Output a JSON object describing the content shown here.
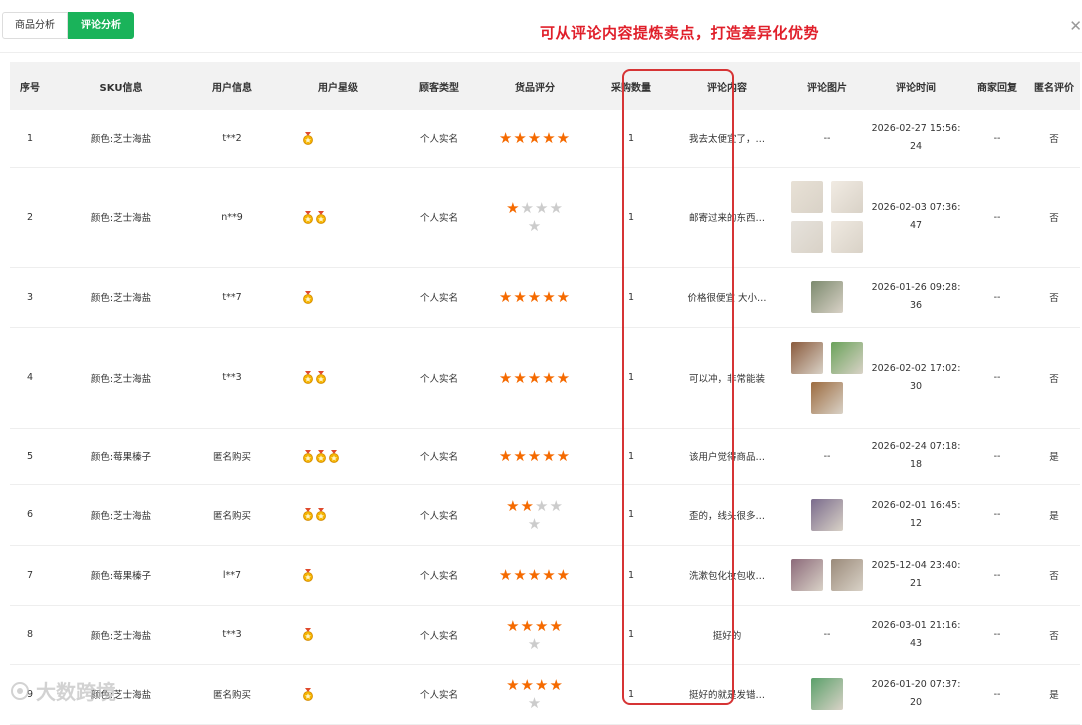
{
  "tabs": [
    {
      "label": "商品分析",
      "active": false
    },
    {
      "label": "评论分析",
      "active": true
    }
  ],
  "headline": "可从评论内容提炼卖点，打造差异化优势",
  "close_icon": "✕",
  "table": {
    "columns": [
      "序号",
      "SKU信息",
      "用户信息",
      "用户星级",
      "顾客类型",
      "货品评分",
      "采购数量",
      "评论内容",
      "评论图片",
      "评论时间",
      "商家回复",
      "匿名评价"
    ],
    "rows": [
      {
        "no": "1",
        "sku": "颜色:芝士海盐",
        "user": "t**2",
        "medals": 1,
        "type": "个人实名",
        "rating": 5,
        "qty": "1",
        "comment": "我去太便宜了，…",
        "images": [],
        "time_a": "2026-02-27 15:56:",
        "time_b": "24",
        "reply": "--",
        "anon": "否"
      },
      {
        "no": "2",
        "sku": "颜色:芝士海盐",
        "user": "n**9",
        "medals": 2,
        "type": "个人实名",
        "rating": 1,
        "qty": "1",
        "comment": "邮寄过来的东西…",
        "images": [
          "#e8e1d6",
          "#f1ebe3",
          "#e6e2dc",
          "#efe9e1"
        ],
        "time_a": "2026-02-03 07:36:",
        "time_b": "47",
        "reply": "--",
        "anon": "否"
      },
      {
        "no": "3",
        "sku": "颜色:芝士海盐",
        "user": "t**7",
        "medals": 1,
        "type": "个人实名",
        "rating": 5,
        "qty": "1",
        "comment": "价格很便宜 大小…",
        "images": [
          "#7c8a6e"
        ],
        "time_a": "2026-01-26 09:28:",
        "time_b": "36",
        "reply": "--",
        "anon": "否"
      },
      {
        "no": "4",
        "sku": "颜色:芝士海盐",
        "user": "t**3",
        "medals": 2,
        "type": "个人实名",
        "rating": 5,
        "qty": "1",
        "comment": "可以冲，非常能装",
        "images": [
          "#8a5a3c",
          "#6aa25a",
          "#9c6b3f"
        ],
        "time_a": "2026-02-02 17:02:",
        "time_b": "30",
        "reply": "--",
        "anon": "否"
      },
      {
        "no": "5",
        "sku": "颜色:莓果榛子",
        "user": "匿名购买",
        "medals": 3,
        "type": "个人实名",
        "rating": 5,
        "qty": "1",
        "comment": "该用户觉得商品…",
        "images": [],
        "time_a": "2026-02-24 07:18:",
        "time_b": "18",
        "reply": "--",
        "anon": "是"
      },
      {
        "no": "6",
        "sku": "颜色:芝士海盐",
        "user": "匿名购买",
        "medals": 2,
        "type": "个人实名",
        "rating": 2,
        "qty": "1",
        "comment": "歪的，线头很多…",
        "images": [
          "#7a6b8c"
        ],
        "time_a": "2026-02-01 16:45:",
        "time_b": "12",
        "reply": "--",
        "anon": "是"
      },
      {
        "no": "7",
        "sku": "颜色:莓果榛子",
        "user": "l**7",
        "medals": 1,
        "type": "个人实名",
        "rating": 5,
        "qty": "1",
        "comment": "洗漱包化妆包收…",
        "images": [
          "#8c6a7a",
          "#9a8a7a"
        ],
        "time_a": "2025-12-04 23:40:",
        "time_b": "21",
        "reply": "--",
        "anon": "否"
      },
      {
        "no": "8",
        "sku": "颜色:芝士海盐",
        "user": "t**3",
        "medals": 1,
        "type": "个人实名",
        "rating": 4,
        "qty": "1",
        "comment": "挺好的",
        "images": [],
        "time_a": "2026-03-01 21:16:",
        "time_b": "43",
        "reply": "--",
        "anon": "否"
      },
      {
        "no": "9",
        "sku": "颜色:芝士海盐",
        "user": "匿名购买",
        "medals": 1,
        "type": "个人实名",
        "rating": 4,
        "qty": "1",
        "comment": "挺好的就是发错…",
        "images": [
          "#5aa06a"
        ],
        "time_a": "2026-01-20 07:37:",
        "time_b": "20",
        "reply": "--",
        "anon": "是"
      }
    ]
  },
  "no_image_text": "--",
  "watermark": "大数跨境",
  "colors": {
    "accent": "#1ab35a",
    "headline": "#e01f2a",
    "star": "#f56a00",
    "highlight": "#d63435"
  }
}
